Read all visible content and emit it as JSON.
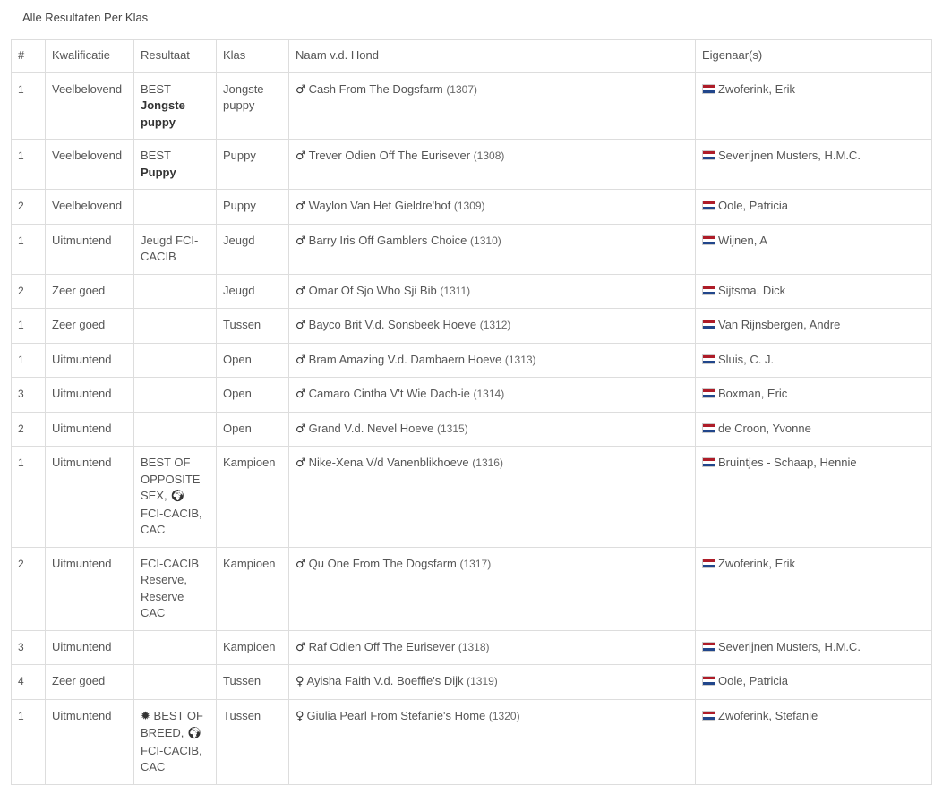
{
  "page": {
    "title": "Alle Resultaten Per Klas"
  },
  "table": {
    "headers": {
      "num": "#",
      "kwalificatie": "Kwalificatie",
      "resultaat": "Resultaat",
      "klas": "Klas",
      "naam": "Naam v.d. Hond",
      "eigenaar": "Eigenaar(s)"
    },
    "rows": [
      {
        "num": "1",
        "kwalificatie": "Veelbelovend",
        "res_prefix": "BEST",
        "res_bold": "Jongste puppy",
        "klas": "Jongste puppy",
        "sex": "male",
        "sex_icon": "♂",
        "naam": "Cash From The Dogsfarm",
        "dog_id": "(1307)",
        "flag": "nl-flag-icon",
        "eigenaar": "Zwoferink, Erik"
      },
      {
        "num": "1",
        "kwalificatie": "Veelbelovend",
        "res_prefix": "BEST",
        "res_bold": "Puppy",
        "klas": "Puppy",
        "sex": "male",
        "sex_icon": "♂",
        "naam": "Trever Odien Off The Eurisever",
        "dog_id": "(1308)",
        "flag": "nl-flag-icon",
        "eigenaar": "Severijnen Musters, H.M.C."
      },
      {
        "num": "2",
        "kwalificatie": "Veelbelovend",
        "klas": "Puppy",
        "sex": "male",
        "sex_icon": "♂",
        "naam": "Waylon Van Het Gieldre'hof",
        "dog_id": "(1309)",
        "flag": "nl-flag-icon",
        "eigenaar": "Oole, Patricia"
      },
      {
        "num": "1",
        "kwalificatie": "Uitmuntend",
        "res_text": "Jeugd FCI-CACIB",
        "klas": "Jeugd",
        "sex": "male",
        "sex_icon": "♂",
        "naam": "Barry Iris Off Gamblers Choice",
        "dog_id": "(1310)",
        "flag": "nl-flag-icon",
        "eigenaar": "Wijnen, A"
      },
      {
        "num": "2",
        "kwalificatie": "Zeer goed",
        "klas": "Jeugd",
        "sex": "male",
        "sex_icon": "♂",
        "naam": "Omar Of Sjo Who Sji Bib",
        "dog_id": "(1311)",
        "flag": "nl-flag-icon",
        "eigenaar": "Sijtsma, Dick"
      },
      {
        "num": "1",
        "kwalificatie": "Zeer goed",
        "klas": "Tussen",
        "sex": "male",
        "sex_icon": "♂",
        "naam": "Bayco Brit V.d. Sonsbeek Hoeve",
        "dog_id": "(1312)",
        "flag": "nl-flag-icon",
        "eigenaar": "Van Rijnsbergen, Andre"
      },
      {
        "num": "1",
        "kwalificatie": "Uitmuntend",
        "klas": "Open",
        "sex": "male",
        "sex_icon": "♂",
        "naam": "Bram Amazing V.d. Dambaern Hoeve",
        "dog_id": "(1313)",
        "flag": "nl-flag-icon",
        "eigenaar": "Sluis, C. J."
      },
      {
        "num": "3",
        "kwalificatie": "Uitmuntend",
        "klas": "Open",
        "sex": "male",
        "sex_icon": "♂",
        "naam": "Camaro Cintha V't Wie Dach-ie",
        "dog_id": "(1314)",
        "flag": "nl-flag-icon",
        "eigenaar": "Boxman, Eric"
      },
      {
        "num": "2",
        "kwalificatie": "Uitmuntend",
        "klas": "Open",
        "sex": "male",
        "sex_icon": "♂",
        "naam": "Grand V.d. Nevel Hoeve",
        "dog_id": "(1315)",
        "flag": "nl-flag-icon",
        "eigenaar": "de Croon, Yvonne"
      },
      {
        "num": "1",
        "kwalificatie": "Uitmuntend",
        "res_before_globe": "BEST OF OPPOSITE SEX,",
        "res_globe": "🌍︎",
        "res_after_globe": "FCI-CACIB, CAC",
        "klas": "Kampioen",
        "sex": "male",
        "sex_icon": "♂",
        "naam": "Nike-Xena V/d Vanenblikhoeve",
        "dog_id": "(1316)",
        "flag": "nl-flag-icon",
        "eigenaar": "Bruintjes - Schaap, Hennie"
      },
      {
        "num": "2",
        "kwalificatie": "Uitmuntend",
        "res_text": "FCI-CACIB Reserve, Reserve CAC",
        "klas": "Kampioen",
        "sex": "male",
        "sex_icon": "♂",
        "naam": "Qu One From The Dogsfarm",
        "dog_id": "(1317)",
        "flag": "nl-flag-icon",
        "eigenaar": "Zwoferink, Erik"
      },
      {
        "num": "3",
        "kwalificatie": "Uitmuntend",
        "klas": "Kampioen",
        "sex": "male",
        "sex_icon": "♂",
        "naam": "Raf Odien Off The Eurisever",
        "dog_id": "(1318)",
        "flag": "nl-flag-icon",
        "eigenaar": "Severijnen Musters, H.M.C."
      },
      {
        "num": "4",
        "kwalificatie": "Zeer goed",
        "klas": "Tussen",
        "sex": "female",
        "sex_icon": "♀",
        "naam": "Ayisha Faith V.d. Boeffie's Dijk",
        "dog_id": "(1319)",
        "flag": "nl-flag-icon",
        "eigenaar": "Oole, Patricia"
      },
      {
        "num": "1",
        "kwalificatie": "Uitmuntend",
        "res_star": "✹",
        "res_before_globe": "BEST OF BREED,",
        "res_globe": "🌍︎",
        "res_after_globe": "FCI-CACIB, CAC",
        "klas": "Tussen",
        "sex": "female",
        "sex_icon": "♀",
        "naam": "Giulia Pearl From Stefanie's Home",
        "dog_id": "(1320)",
        "flag": "nl-flag-icon",
        "eigenaar": "Zwoferink, Stefanie"
      }
    ]
  }
}
